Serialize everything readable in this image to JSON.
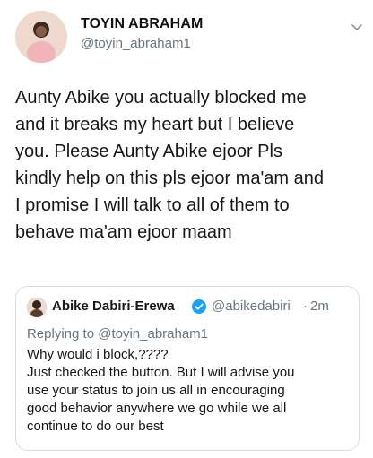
{
  "header": {
    "display_name": "TOYIN ABRAHAM",
    "handle": "@toyin_abraham1",
    "avatar_icon": "person-avatar",
    "menu_icon": "chevron-down-icon"
  },
  "tweet": {
    "text": "Aunty Abike you actually blocked me\nand it breaks my heart but I believe\nyou. Please Aunty Abike ejoor Pls\nkindly help on this pls ejoor ma'am and\nI promise I will talk to all of them to\nbehave ma'am ejoor maam"
  },
  "quoted_tweet": {
    "author_name": "Abike Dabiri-Erewa",
    "verified_icon": "verified-badge-icon",
    "handle": "@abikedabiri",
    "separator": "·",
    "time": "2m",
    "replying_prefix": "Replying to ",
    "replying_to": "@toyin_abraham1",
    "text": "Why would i block,????\nJust checked the button. But I will advise you\nuse your status to join us all in encouraging\ngood behavior anywhere we go while we all\ncontinue to do our best"
  },
  "colors": {
    "text": "#14171a",
    "secondary": "#66757f",
    "verified": "#1da1f2",
    "border": "#d7dde2"
  }
}
